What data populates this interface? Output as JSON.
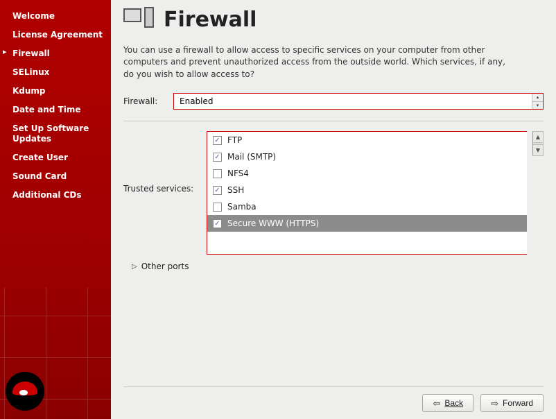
{
  "sidebar": {
    "items": [
      {
        "label": "Welcome",
        "active": false
      },
      {
        "label": "License Agreement",
        "active": false
      },
      {
        "label": "Firewall",
        "active": true
      },
      {
        "label": "SELinux",
        "active": false
      },
      {
        "label": "Kdump",
        "active": false
      },
      {
        "label": "Date and Time",
        "active": false
      },
      {
        "label": "Set Up Software Updates",
        "active": false
      },
      {
        "label": "Create User",
        "active": false
      },
      {
        "label": "Sound Card",
        "active": false
      },
      {
        "label": "Additional CDs",
        "active": false
      }
    ]
  },
  "header": {
    "title": "Firewall"
  },
  "intro_text": "You can use a firewall to allow access to specific services on your computer from other computers and prevent unauthorized access from the outside world.  Which services, if any, do you wish to allow access to?",
  "firewall": {
    "label": "Firewall:",
    "value": "Enabled"
  },
  "trusted": {
    "label": "Trusted services:",
    "services": [
      {
        "name": "FTP",
        "checked": true,
        "selected": false
      },
      {
        "name": "Mail (SMTP)",
        "checked": true,
        "selected": false
      },
      {
        "name": "NFS4",
        "checked": false,
        "selected": false
      },
      {
        "name": "SSH",
        "checked": true,
        "selected": false
      },
      {
        "name": "Samba",
        "checked": false,
        "selected": false
      },
      {
        "name": "Secure WWW (HTTPS)",
        "checked": true,
        "selected": true
      }
    ]
  },
  "other_ports_label": "Other ports",
  "buttons": {
    "back": "Back",
    "forward": "Forward"
  }
}
